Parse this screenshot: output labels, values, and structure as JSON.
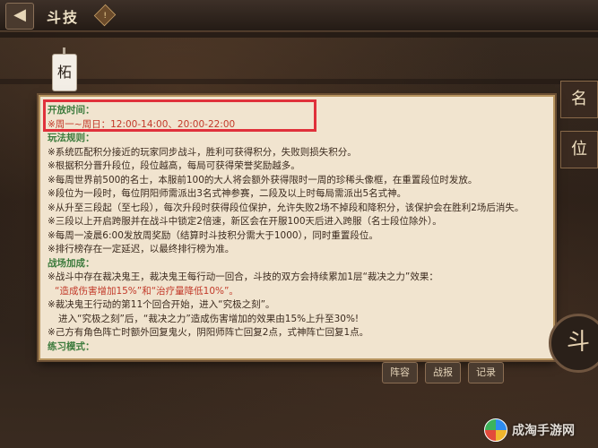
{
  "topbar": {
    "title": "斗技",
    "back_icon": "◀",
    "info_icon": "!"
  },
  "tag_label": "柘",
  "side_labels": [
    "名",
    "位"
  ],
  "panel": {
    "section1_heading": "开放时间：",
    "section1_time": "※周一~周日：12:00-14:00、20:00-22:00",
    "section2_heading": "玩法规则：",
    "rules": [
      "※系统匹配积分接近的玩家同步战斗，胜利可获得积分，失败则损失积分。",
      "※根据积分晋升段位，段位越高，每局可获得荣誉奖励越多。",
      "※每周世界前500的名士，本服前100的大人将会额外获得限时一周的珍稀头像框，在重置段位时发放。",
      "※段位为一段时，每位阴阳师需派出3名式神参赛，二段及以上时每局需派出5名式神。",
      "※从升至三段起（至七段），每次升段时获得段位保护，允许失败2场不掉段和降积分，该保护会在胜利2场后消失。",
      "※三段以上开启跨服并在战斗中锁定2倍速，新区会在开服100天后进入跨服（名士段位除外）。",
      "※每周一凌晨6:00发放周奖励（结算时斗技积分需大于1000），同时重置段位。",
      "※排行榜存在一定延迟，以最终排行榜为准。"
    ],
    "section3_heading": "战场加成：",
    "bonus": [
      "※战斗中存在裁决鬼王，裁决鬼王每行动一回合，斗技的双方会持续累加1层“裁决之力”效果：",
      "“造成伤害增加15%”和“治疗量降低10%”。",
      "※裁决鬼王行动的第11个回合开始，进入“究极之刻”。",
      "进入“究极之刻”后，“裁决之力”造成伤害增加的效果由15%上升至30%!",
      "※己方有角色阵亡时额外回复鬼火，阴阳师阵亡回复2点，式神阵亡回复1点。"
    ],
    "section4_heading": "练习模式："
  },
  "bottom_buttons": [
    "阵容",
    "战报",
    "记录"
  ],
  "big_circle_label": "斗",
  "watermark": {
    "text": "成淘手游网"
  }
}
